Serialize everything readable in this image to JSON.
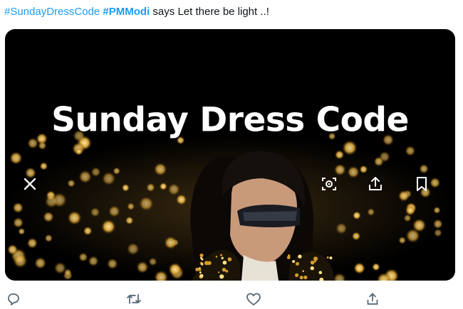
{
  "tweet": {
    "hashtag_1": "#SundayDressCode",
    "hashtag_2": "#PMModi",
    "rest_text": " says Let there be light ..!"
  },
  "media": {
    "caption": "Sunday Dress Code",
    "controls": {
      "close_icon": "close-icon",
      "lens_icon": "visual-search-icon",
      "share_icon": "share-icon",
      "bookmark_icon": "bookmark-icon"
    }
  },
  "actions": {
    "reply_icon": "reply-icon",
    "retweet_icon": "retweet-icon",
    "like_icon": "heart-icon",
    "share_icon": "share-icon"
  },
  "colors": {
    "hashtag": "#1d9bf0",
    "action_icon": "#536471",
    "media_background": "#000000"
  }
}
